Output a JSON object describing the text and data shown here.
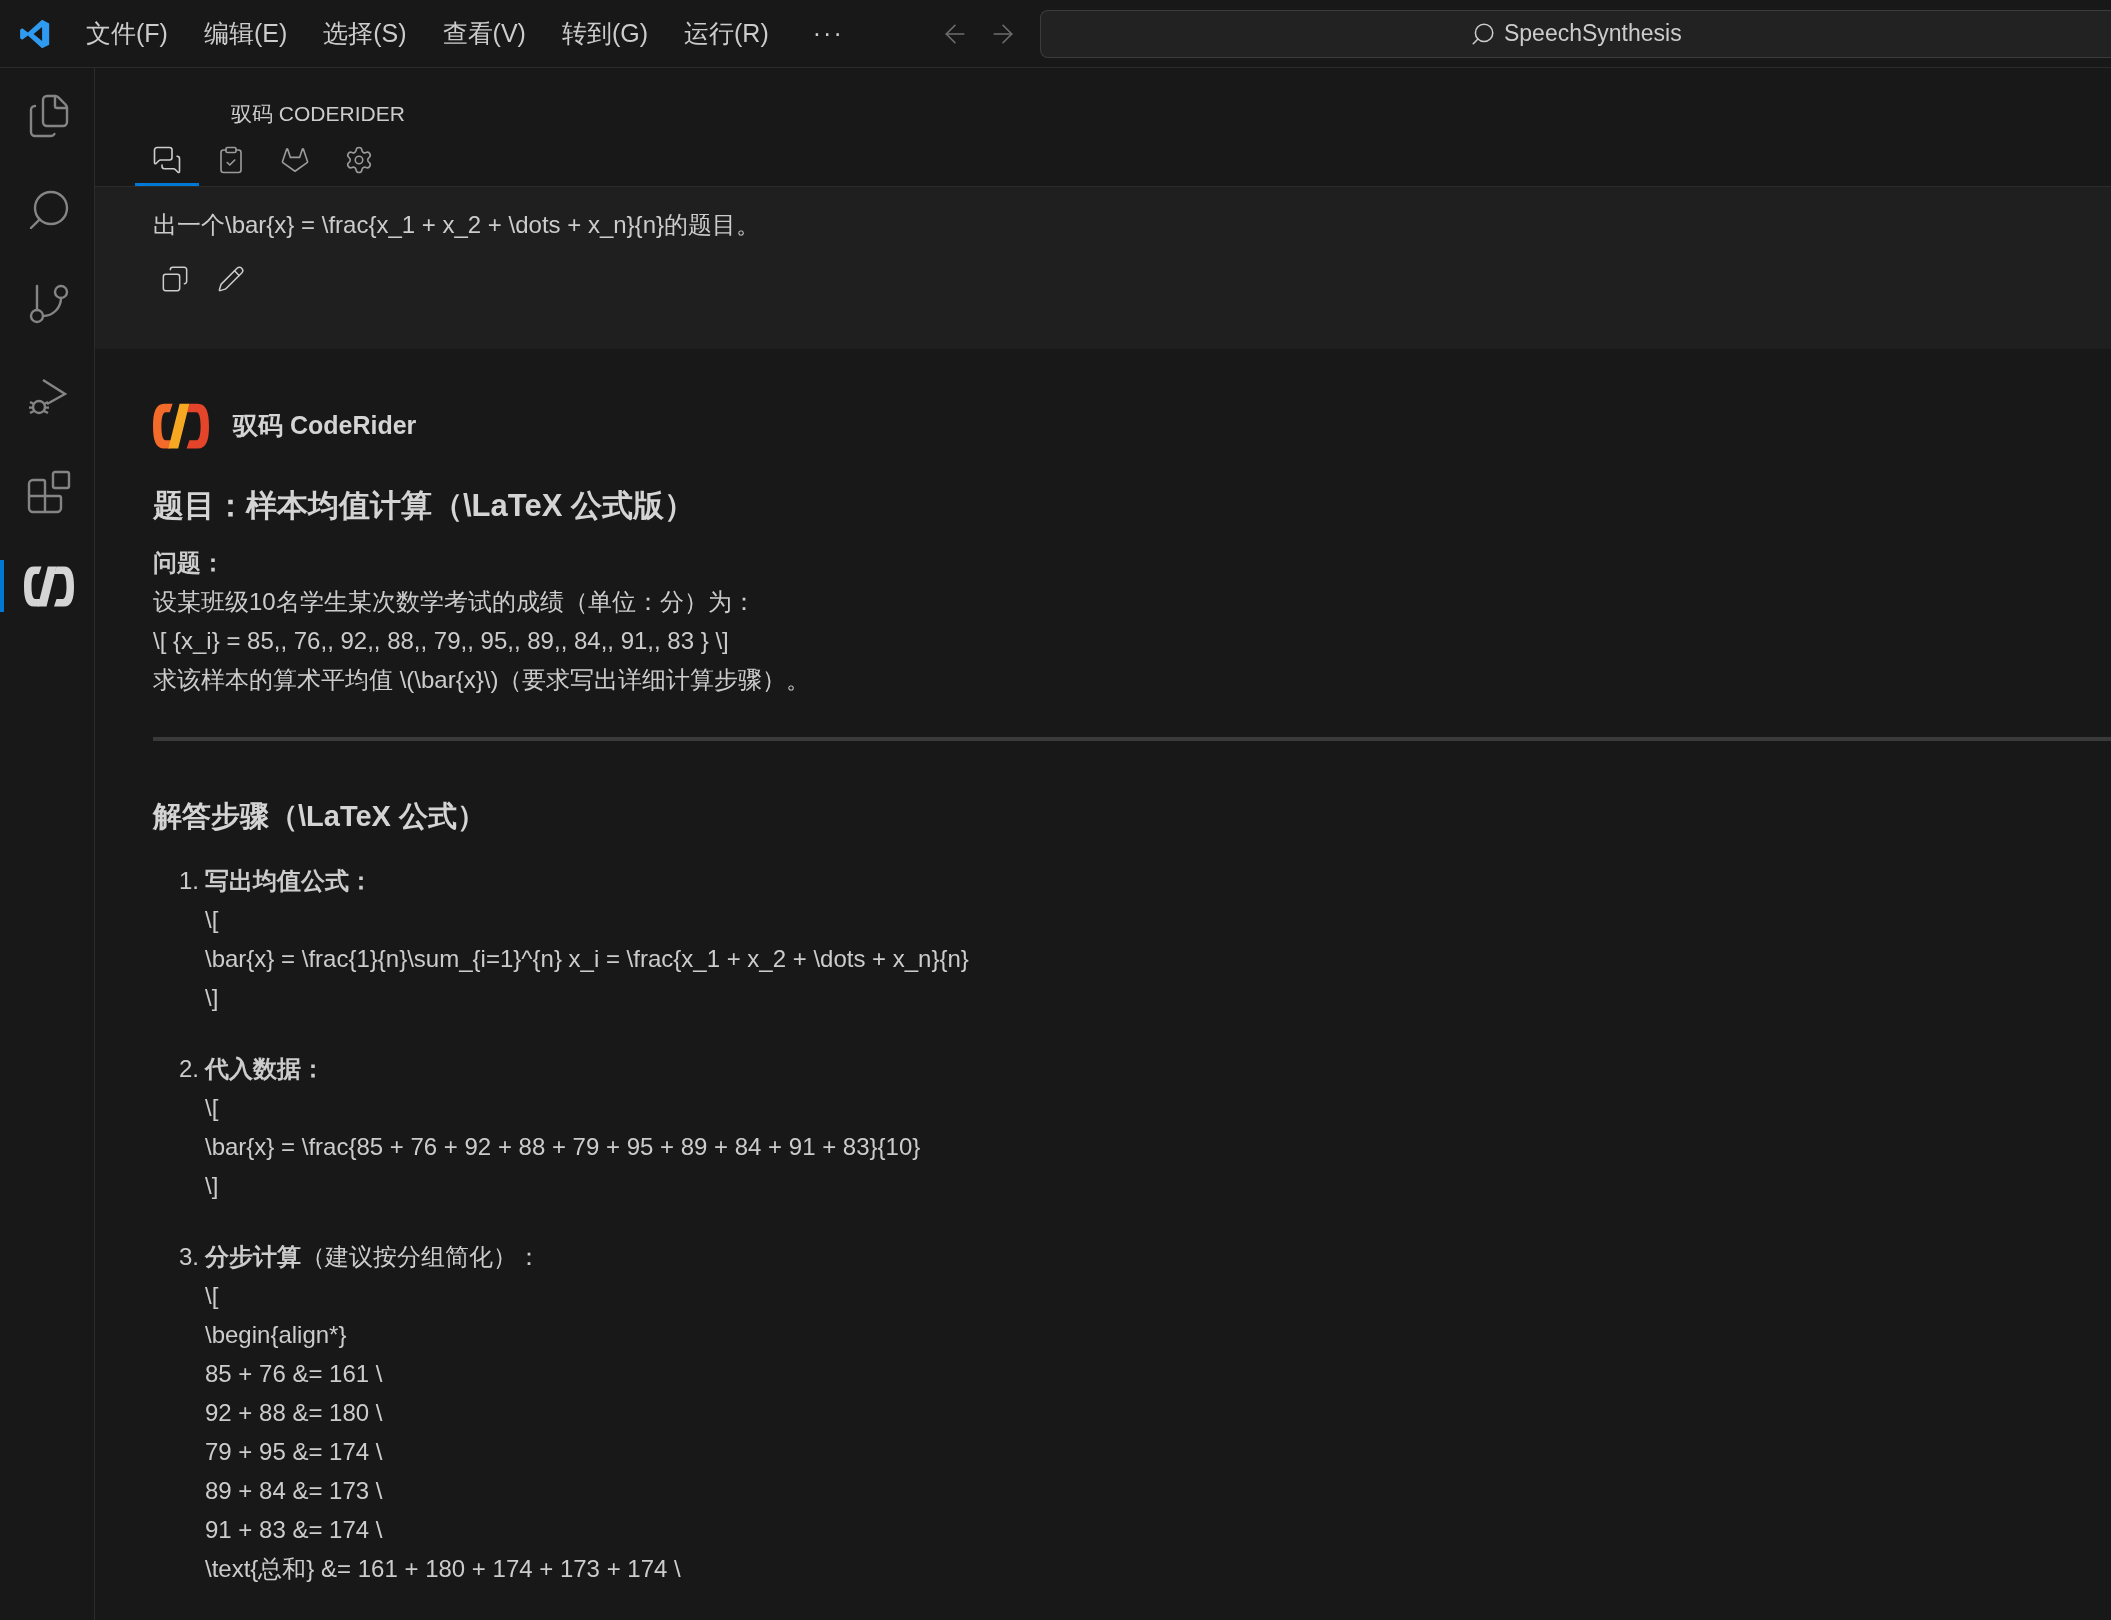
{
  "menu_bar": {
    "items": [
      "文件(F)",
      "编辑(E)",
      "选择(S)",
      "查看(V)",
      "转到(G)",
      "运行(R)"
    ],
    "more": "···"
  },
  "search": {
    "value": "SpeechSynthesis"
  },
  "activity_bar": {
    "items": [
      {
        "kind": "explorer",
        "selected": false
      },
      {
        "kind": "search",
        "selected": false
      },
      {
        "kind": "source-control",
        "selected": false
      },
      {
        "kind": "run-debug",
        "selected": false
      },
      {
        "kind": "extensions",
        "selected": false
      },
      {
        "kind": "coderider",
        "selected": true
      }
    ]
  },
  "panel": {
    "title": "驭码 CODERIDER",
    "tabs": [
      {
        "kind": "chat",
        "selected": true
      },
      {
        "kind": "tasks",
        "selected": false
      },
      {
        "kind": "gitlab",
        "selected": false
      },
      {
        "kind": "settings",
        "selected": false
      }
    ]
  },
  "user_message": {
    "text": "出一个\\bar{x} = \\frac{x_1 + x_2 + \\dots + x_n}{n}的题目。"
  },
  "response": {
    "author": "驭码 CodeRider",
    "title": "题目：样本均值计算（\\LaTeX 公式版）",
    "question_label": "问题：",
    "question_lines": [
      "设某班级10名学生某次数学考试的成绩（单位：分）为：",
      "\\[ {x_i} = 85,, 76,, 92,, 88,, 79,, 95,, 89,, 84,, 91,, 83 } \\]",
      "求该样本的算术平均值 \\(\\bar{x}\\)（要求写出详细计算步骤）。"
    ],
    "section_heading": "解答步骤（\\LaTeX 公式）",
    "steps": [
      {
        "number": "1.",
        "title": "写出均值公式：",
        "lines": [
          "\\[",
          "\\bar{x} = \\frac{1}{n}\\sum_{i=1}^{n} x_i = \\frac{x_1 + x_2 + \\dots + x_n}{n}",
          "\\]"
        ]
      },
      {
        "number": "2.",
        "title": "代入数据：",
        "lines": [
          "\\[",
          "\\bar{x} = \\frac{85 + 76 + 92 + 88 + 79 + 95 + 89 + 84 + 91 + 83}{10}",
          "\\]"
        ]
      },
      {
        "number": "3.",
        "title": "分步计算",
        "note": "（建议按分组简化）：",
        "lines": [
          "\\[",
          "\\begin{align*}",
          "85 + 76 &= 161 \\",
          "92 + 88 &= 180 \\",
          "79 + 95 &= 174 \\",
          "89 + 84 &= 173 \\",
          "91 + 83 &= 174 \\",
          "\\text{总和} &= 161 + 180 + 174 + 173 + 174 \\"
        ]
      }
    ]
  }
}
